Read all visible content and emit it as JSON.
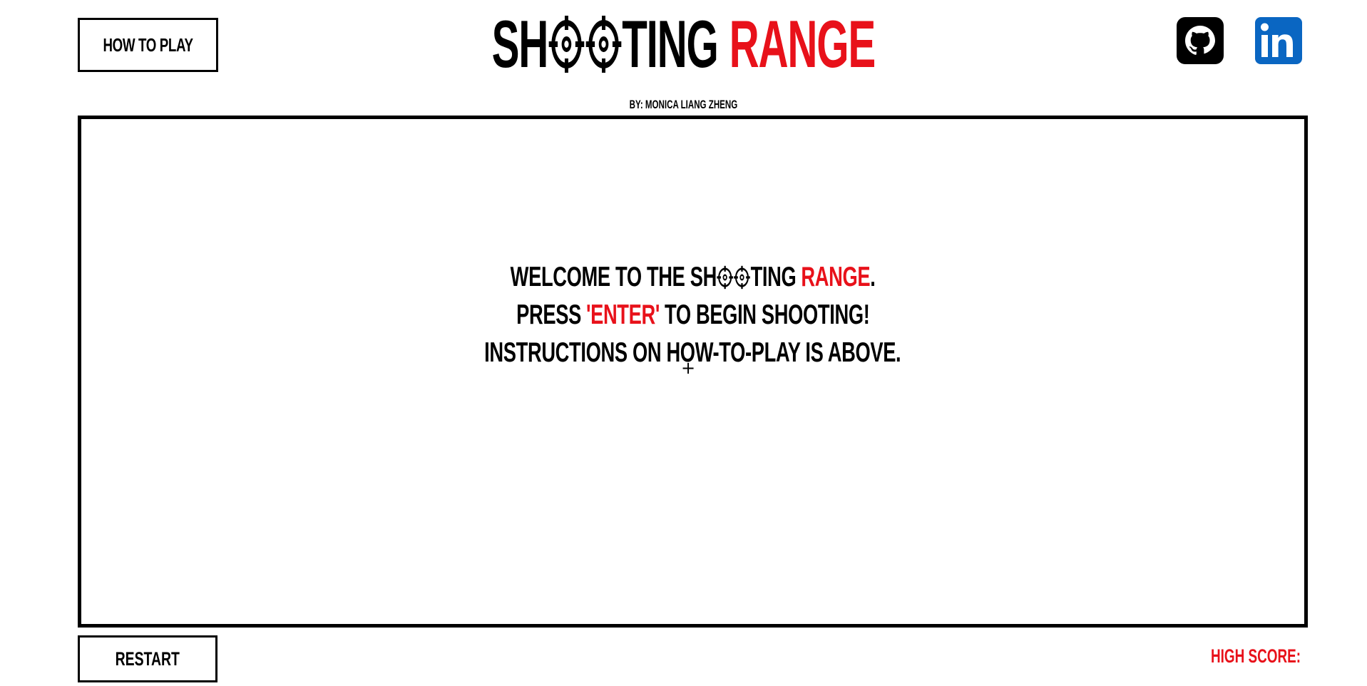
{
  "header": {
    "how_to_play_label": "HOW TO PLAY",
    "title_part1_a": "SH",
    "title_part1_b": "TING",
    "title_part2": "RANGE",
    "byline": "BY: MONICA LIANG ZHENG",
    "github_icon": "github-icon",
    "linkedin_icon": "linkedin-icon"
  },
  "board": {
    "line1_a": "WELCOME TO THE SH",
    "line1_b": "TING",
    "line1_c": "RANGE",
    "line1_d": ".",
    "line2_a": "PRESS",
    "line2_b": "'ENTER'",
    "line2_c": "TO BEGIN SHOOTING!",
    "line3": "INSTRUCTIONS ON HOW-TO-PLAY IS ABOVE.",
    "crosshair_cursor": "+"
  },
  "footer": {
    "restart_label": "RESTART",
    "high_score_label": "HIGH SCORE:"
  },
  "colors": {
    "accent": "#e8111a",
    "text": "#000000",
    "background": "#ffffff",
    "linkedin": "#0a66c2"
  }
}
